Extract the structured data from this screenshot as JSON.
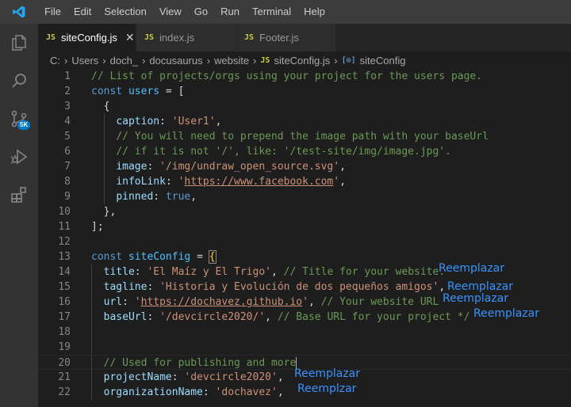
{
  "menu": [
    "File",
    "Edit",
    "Selection",
    "View",
    "Go",
    "Run",
    "Terminal",
    "Help"
  ],
  "activity": {
    "source_control_badge": "5K"
  },
  "tabs": [
    {
      "label": "siteConfig.js",
      "active": true
    },
    {
      "label": "index.js",
      "active": false
    },
    {
      "label": "Footer.js",
      "active": false
    }
  ],
  "tab_icon": "JS",
  "breadcrumb": [
    "C:",
    "Users",
    "doch_",
    "docusaurus",
    "website",
    "siteConfig.js",
    "siteConfig"
  ],
  "lines": [
    {
      "n": "1",
      "tokens": [
        [
          "cm",
          "// List of projects/orgs using your project for the users page."
        ]
      ]
    },
    {
      "n": "2",
      "tokens": [
        [
          "kw",
          "const "
        ],
        [
          "var",
          "users"
        ],
        [
          "pun",
          " = ["
        ]
      ]
    },
    {
      "n": "3",
      "tokens": [
        [
          "pun",
          "  {"
        ]
      ]
    },
    {
      "n": "4",
      "tokens": [
        [
          "pun",
          "    "
        ],
        [
          "prop",
          "caption"
        ],
        [
          "pun",
          ": "
        ],
        [
          "str",
          "'User1'"
        ],
        [
          "pun",
          ","
        ]
      ]
    },
    {
      "n": "5",
      "tokens": [
        [
          "pun",
          "    "
        ],
        [
          "cm",
          "// You will need to prepend the image path with your baseUrl"
        ]
      ]
    },
    {
      "n": "6",
      "tokens": [
        [
          "pun",
          "    "
        ],
        [
          "cm",
          "// if it is not '/', like: '/test-site/img/image.jpg'."
        ]
      ]
    },
    {
      "n": "7",
      "tokens": [
        [
          "pun",
          "    "
        ],
        [
          "prop",
          "image"
        ],
        [
          "pun",
          ": "
        ],
        [
          "str",
          "'/img/undraw_open_source.svg'"
        ],
        [
          "pun",
          ","
        ]
      ]
    },
    {
      "n": "8",
      "tokens": [
        [
          "pun",
          "    "
        ],
        [
          "prop",
          "infoLink"
        ],
        [
          "pun",
          ": "
        ],
        [
          "str",
          "'"
        ],
        [
          "url",
          "https://www.facebook.com"
        ],
        [
          "str",
          "'"
        ],
        [
          "pun",
          ","
        ]
      ]
    },
    {
      "n": "9",
      "tokens": [
        [
          "pun",
          "    "
        ],
        [
          "prop",
          "pinned"
        ],
        [
          "pun",
          ": "
        ],
        [
          "kw",
          "true"
        ],
        [
          "pun",
          ","
        ]
      ]
    },
    {
      "n": "10",
      "tokens": [
        [
          "pun",
          "  },"
        ]
      ]
    },
    {
      "n": "11",
      "tokens": [
        [
          "pun",
          "];"
        ]
      ]
    },
    {
      "n": "12",
      "tokens": []
    },
    {
      "n": "13",
      "tokens": [
        [
          "kw",
          "const "
        ],
        [
          "var",
          "siteConfig"
        ],
        [
          "pun",
          " = "
        ],
        [
          "brace",
          "{"
        ]
      ]
    },
    {
      "n": "14",
      "tokens": [
        [
          "pun",
          "  "
        ],
        [
          "prop",
          "title"
        ],
        [
          "pun",
          ": "
        ],
        [
          "str",
          "'El Maíz y El Trigo'"
        ],
        [
          "pun",
          ", "
        ],
        [
          "cm",
          "// Title for your website."
        ]
      ]
    },
    {
      "n": "15",
      "tokens": [
        [
          "pun",
          "  "
        ],
        [
          "prop",
          "tagline"
        ],
        [
          "pun",
          ": "
        ],
        [
          "str",
          "'Historia y Evolución de dos pequeños amigos'"
        ],
        [
          "pun",
          ","
        ]
      ]
    },
    {
      "n": "16",
      "tokens": [
        [
          "pun",
          "  "
        ],
        [
          "prop",
          "url"
        ],
        [
          "pun",
          ": "
        ],
        [
          "str",
          "'"
        ],
        [
          "url",
          "https://dochavez.github.io"
        ],
        [
          "str",
          "'"
        ],
        [
          "pun",
          ", "
        ],
        [
          "cm",
          "// Your website URL"
        ]
      ]
    },
    {
      "n": "17",
      "tokens": [
        [
          "pun",
          "  "
        ],
        [
          "prop",
          "baseUrl"
        ],
        [
          "pun",
          ": "
        ],
        [
          "str",
          "'/devcircle2020/'"
        ],
        [
          "pun",
          ", "
        ],
        [
          "cm",
          "// Base URL for your project */"
        ]
      ]
    },
    {
      "n": "18",
      "tokens": []
    },
    {
      "n": "19",
      "tokens": []
    },
    {
      "n": "20",
      "tokens": [
        [
          "pun",
          "  "
        ],
        [
          "cm",
          "// Used for publishing and more"
        ]
      ]
    },
    {
      "n": "21",
      "tokens": [
        [
          "pun",
          "  "
        ],
        [
          "prop",
          "projectName"
        ],
        [
          "pun",
          ": "
        ],
        [
          "str",
          "'devcircle2020'"
        ],
        [
          "pun",
          ","
        ]
      ]
    },
    {
      "n": "22",
      "tokens": [
        [
          "pun",
          "  "
        ],
        [
          "prop",
          "organizationName"
        ],
        [
          "pun",
          ": "
        ],
        [
          "str",
          "'dochavez'"
        ],
        [
          "pun",
          ","
        ]
      ]
    }
  ],
  "annotations": [
    {
      "line": "14",
      "text": "Reemplazar"
    },
    {
      "line": "15",
      "text": "Reemplazar"
    },
    {
      "line": "16",
      "text": "Reemplazar"
    },
    {
      "line": "17",
      "text": "Reemplazar"
    },
    {
      "line": "21",
      "text": "Reemplazar"
    },
    {
      "line": "22",
      "text": "Reemplzar"
    }
  ],
  "colors": {
    "accent": "#007acc",
    "annotation": "#3794ff",
    "js_icon": "#cbcb41"
  }
}
